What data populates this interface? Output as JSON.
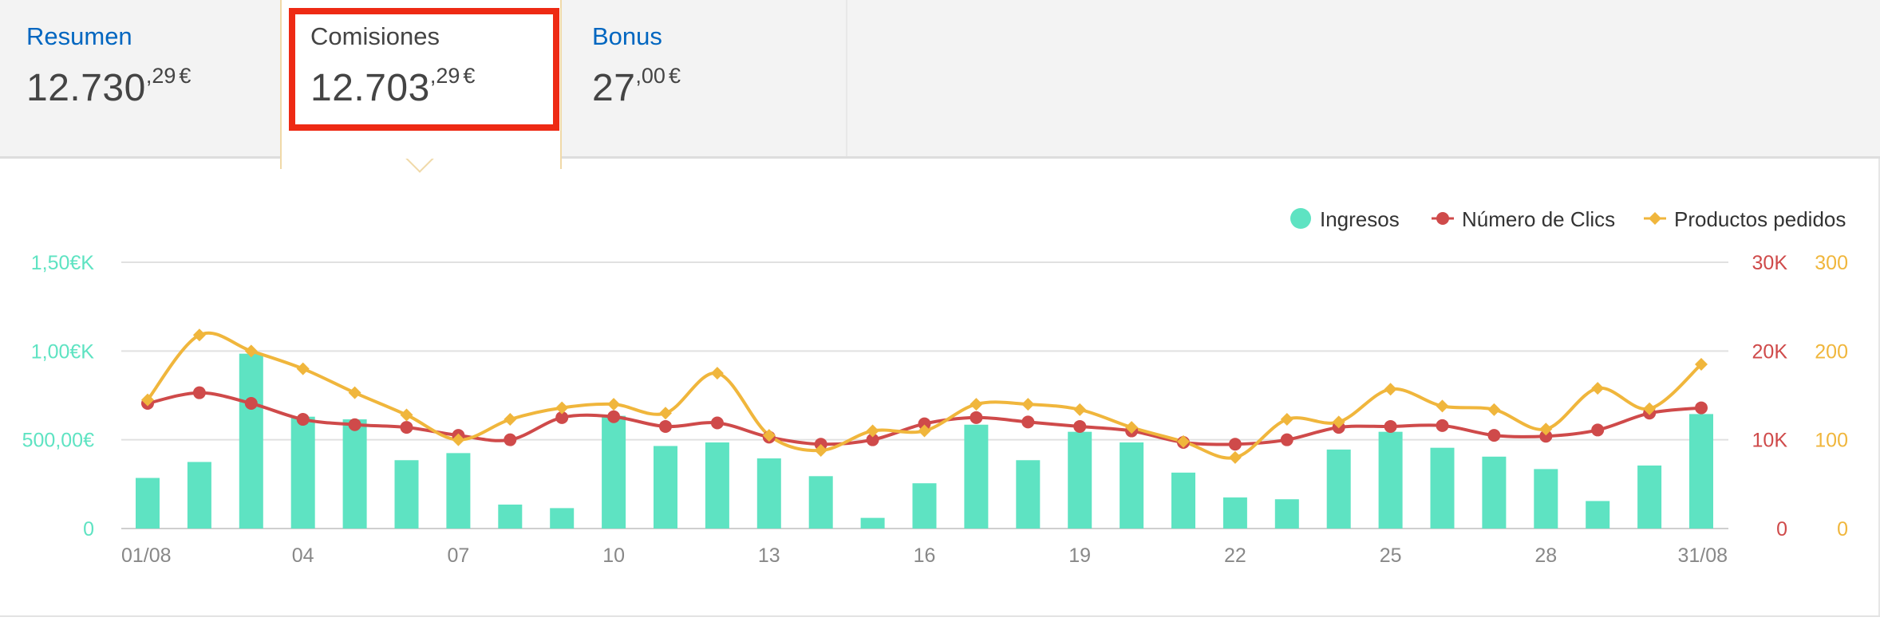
{
  "tabs": [
    {
      "label": "Resumen",
      "amount_int": "12.730",
      "amount_dec": ",29",
      "currency": "€"
    },
    {
      "label": "Comisiones",
      "amount_int": "12.703",
      "amount_dec": ",29",
      "currency": "€"
    },
    {
      "label": "Bonus",
      "amount_int": "27",
      "amount_dec": ",00",
      "currency": "€"
    }
  ],
  "colors": {
    "ingresos": "#5ee3c2",
    "clics": "#cf4a4a",
    "productos": "#f0b63c",
    "highlight": "#ee2a14",
    "link": "#0066c0"
  },
  "chart_data": {
    "type": "bar+line",
    "legend": [
      "Ingresos",
      "Número de Clics",
      "Productos pedidos"
    ],
    "legend_position": "top-right",
    "x": [
      "01/08",
      "02",
      "03",
      "04",
      "05",
      "06",
      "07",
      "08",
      "09",
      "10",
      "11",
      "12",
      "13",
      "14",
      "15",
      "16",
      "17",
      "18",
      "19",
      "20",
      "21",
      "22",
      "23",
      "24",
      "25",
      "26",
      "27",
      "28",
      "29",
      "30",
      "31/08"
    ],
    "x_tick_labels": [
      "01/08",
      "04",
      "07",
      "10",
      "13",
      "16",
      "19",
      "22",
      "25",
      "28",
      "31/08"
    ],
    "y_left_ticks": [
      "0",
      "500,00€",
      "1,00€K",
      "1,50€K"
    ],
    "y_right1_ticks": [
      "0",
      "10K",
      "20K",
      "30K"
    ],
    "y_right2_ticks": [
      "0",
      "100",
      "200",
      "300"
    ],
    "y_left_range": [
      0,
      1500
    ],
    "y_right1_range": [
      0,
      30000
    ],
    "y_right2_range": [
      0,
      300
    ],
    "grid": true,
    "series": [
      {
        "name": "Ingresos",
        "type": "bar",
        "axis": "left",
        "values": [
          285,
          375,
          985,
          630,
          615,
          385,
          425,
          135,
          115,
          635,
          465,
          485,
          395,
          295,
          60,
          255,
          585,
          385,
          545,
          485,
          315,
          175,
          165,
          445,
          545,
          455,
          405,
          335,
          155,
          355,
          645
        ]
      },
      {
        "name": "Número de Clics",
        "type": "line",
        "axis": "right1",
        "values": [
          14100,
          15300,
          14100,
          12300,
          11700,
          11400,
          10500,
          10000,
          12500,
          12600,
          11500,
          11900,
          10300,
          9500,
          10000,
          11800,
          12500,
          12000,
          11500,
          11000,
          9700,
          9500,
          10000,
          11400,
          11500,
          11600,
          10500,
          10400,
          11100,
          13000,
          13600
        ]
      },
      {
        "name": "Productos pedidos",
        "type": "line",
        "axis": "right2",
        "values": [
          145,
          218,
          200,
          180,
          153,
          128,
          100,
          123,
          136,
          140,
          130,
          175,
          105,
          88,
          110,
          110,
          140,
          140,
          134,
          114,
          98,
          80,
          123,
          120,
          157,
          138,
          134,
          112,
          158,
          135,
          185
        ]
      }
    ]
  }
}
